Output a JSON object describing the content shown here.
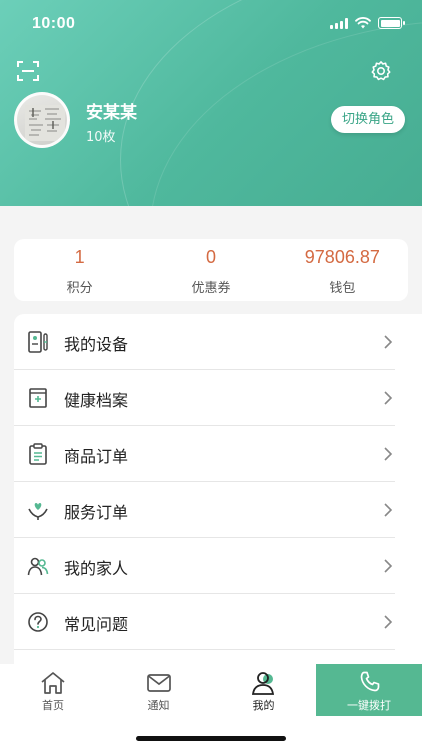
{
  "status_bar": {
    "time": "10:00"
  },
  "profile": {
    "name": "安某某",
    "subtitle": "10枚",
    "switch_role_label": "切换角色"
  },
  "stats": [
    {
      "value": "1",
      "label": "积分"
    },
    {
      "value": "0",
      "label": "优惠券"
    },
    {
      "value": "97806.87",
      "label": "钱包"
    }
  ],
  "menu": [
    {
      "label": "我的设备",
      "icon": "device-icon"
    },
    {
      "label": "健康档案",
      "icon": "health-record-icon"
    },
    {
      "label": "商品订单",
      "icon": "clipboard-icon"
    },
    {
      "label": "服务订单",
      "icon": "care-hands-icon"
    },
    {
      "label": "我的家人",
      "icon": "family-icon"
    },
    {
      "label": "常见问题",
      "icon": "question-icon"
    }
  ],
  "tabbar": {
    "home": "首页",
    "notify": "通知",
    "mine": "我的",
    "call": "一键拨打"
  },
  "colors": {
    "header_start": "#6ccfb9",
    "header_end": "#47ad92",
    "accent": "#55b892",
    "stat_value": "#d46a42"
  }
}
